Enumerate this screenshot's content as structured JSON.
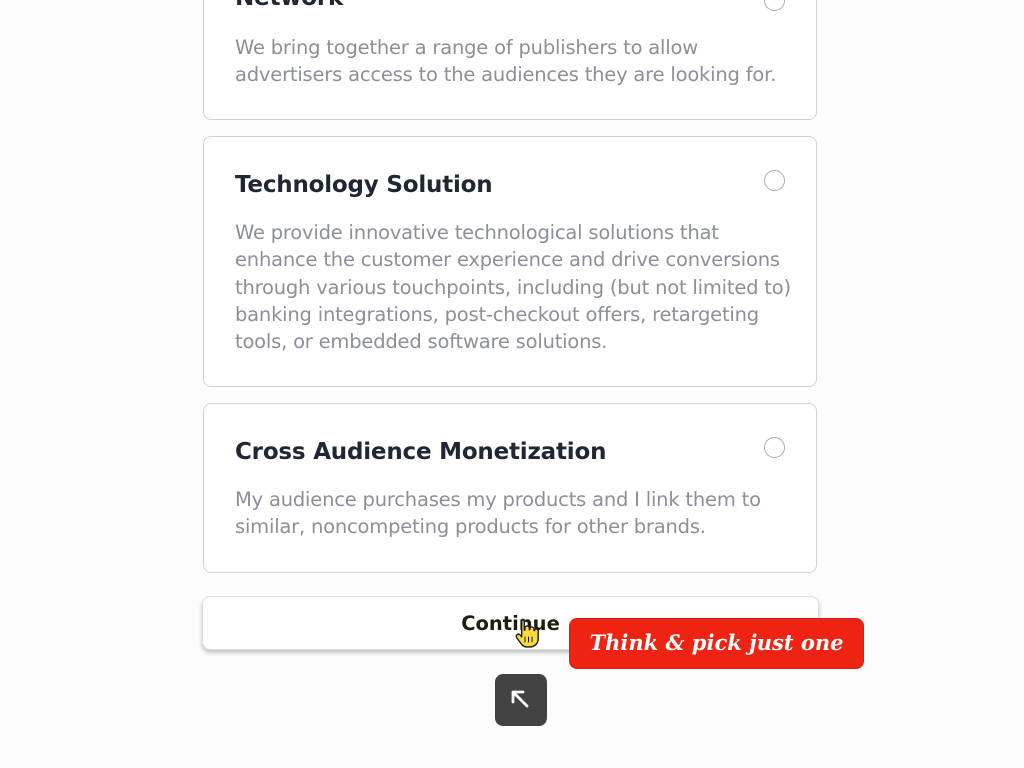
{
  "options": [
    {
      "title": "Network",
      "description": "We bring together a range of publishers to allow advertisers access to the audiences they are looking for."
    },
    {
      "title": "Technology Solution",
      "description": "We provide innovative technological solutions that enhance the customer experience and drive conversions through various touchpoints, including (but not limited to) banking integrations, post-checkout offers, retargeting tools, or embedded software solutions."
    },
    {
      "title": "Cross Audience Monetization",
      "description": "My audience purchases my products and I link them to similar, noncompeting products for other brands."
    }
  ],
  "continue_button": {
    "label": "Continue"
  },
  "tooltip": {
    "text": "Think & pick just one"
  },
  "icons": {
    "cursor": "hand-pointer-icon",
    "back_to_top": "arrow-up-left-icon"
  },
  "colors": {
    "tooltip_bg": "#ee2313",
    "back_to_top_bg": "#424242",
    "title_text": "#1e2733",
    "description_text": "#8a8f99"
  }
}
